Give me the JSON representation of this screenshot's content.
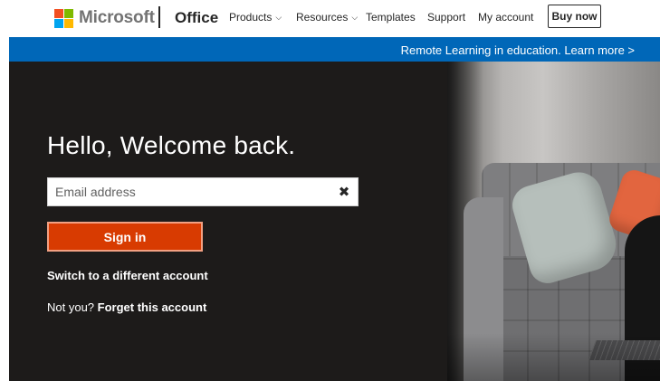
{
  "header": {
    "brand": "Microsoft",
    "product": "Office",
    "nav": [
      {
        "label": "Products",
        "has_dropdown": true
      },
      {
        "label": "Resources",
        "has_dropdown": true
      },
      {
        "label": "Templates",
        "has_dropdown": false
      },
      {
        "label": "Support",
        "has_dropdown": false
      },
      {
        "label": "My account",
        "has_dropdown": false
      }
    ],
    "buy_now": "Buy now"
  },
  "banner": {
    "text": "Remote Learning in education. Learn more >",
    "color": "#0067b8"
  },
  "hero": {
    "title": "Hello, Welcome back.",
    "email_placeholder": "Email address",
    "email_value": "",
    "clear_icon": "close-icon",
    "sign_in": "Sign in",
    "switch_account": "Switch to a different account",
    "not_you": "Not you?",
    "forget_account": "Forget this account"
  },
  "colors": {
    "accent": "#d83b01",
    "hero_background": "#1d1b1a",
    "logo_red": "#f25022",
    "logo_green": "#7fba00",
    "logo_blue": "#00a4ef",
    "logo_yellow": "#ffb900"
  }
}
